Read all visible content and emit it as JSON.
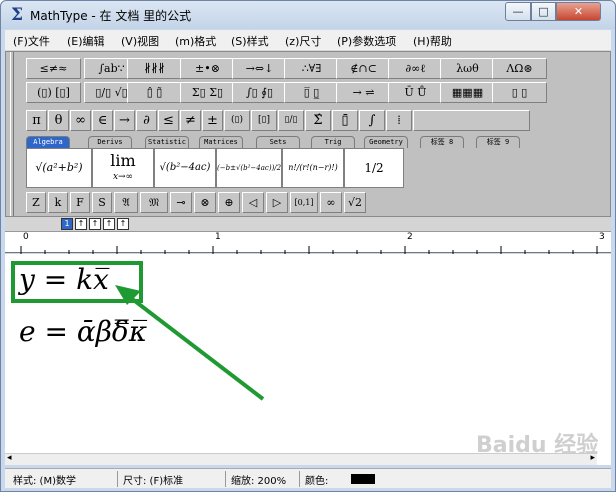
{
  "window": {
    "title": "MathType - 在 文档 里的公式",
    "min": "—",
    "max": "□",
    "close": "✕"
  },
  "menu": [
    "(F)文件",
    "(E)编辑",
    "(V)视图",
    "(m)格式",
    "(S)样式",
    "(z)尺寸",
    "(P)参数选项",
    "(H)帮助"
  ],
  "palettes_row1": [
    "≤≠≈",
    "∫ab∵",
    "∦∦∦",
    "±•⊗",
    "→⇔↓",
    "∴∀∃",
    "∉∩⊂",
    "∂∞ℓ",
    "λωθ",
    "ΛΩ⊛"
  ],
  "palettes_row2": [
    "(▯) [▯]",
    "▯/▯ √▯",
    "▯̂ ▯̃",
    "Σ▯ Σ▯",
    "∫▯ ∮▯",
    "▯̅ ▯̲",
    "→ ⇌",
    "Ū Ů",
    "▦▦▦",
    "▯ ▯"
  ],
  "symbols_row": [
    "π",
    "θ",
    "∞",
    "∈",
    "→",
    "∂",
    "≤",
    "≠",
    "±",
    "(▯)",
    "[▯]",
    "▯/▯",
    "Σ̂",
    "▯̄",
    "∫",
    "⁞"
  ],
  "tabs": [
    "Algebra",
    "Derivs",
    "Statistic",
    "Matrices",
    "Sets",
    "Trig",
    "Geometry",
    "标签 8",
    "标签 9"
  ],
  "templates": [
    "√(a²+b²)",
    "lim",
    "√(b²−4ac)",
    "(−b±√(b²−4ac))/2a",
    "n!/(r!(n−r)!)",
    "1/2"
  ],
  "lim_sub": "x→∞",
  "small_row": [
    "Z",
    "k",
    "F",
    "S",
    "𝔄",
    "𝔐",
    "⊸",
    "⊗",
    "⊕",
    "◁",
    "▷",
    "[0,1]",
    "∞",
    "√2"
  ],
  "size_buttons": [
    "1",
    "↑",
    "↑",
    "↑",
    "↑"
  ],
  "ruler_numbers": [
    "0",
    "1",
    "2",
    "3"
  ],
  "equation1": "y = kx̅",
  "equation2": "e = ᾱβδ̿κ̅",
  "status": {
    "style": "样式:   (M)数学",
    "size": "尺寸:   (F)标准",
    "zoom": "缩放:   200%",
    "color": "颜色:"
  },
  "watermark": "Baidu 经验",
  "colors": {
    "highlight": "#1f9a32",
    "arrow": "#1f9a32",
    "active_tab": "#2f66c9"
  }
}
